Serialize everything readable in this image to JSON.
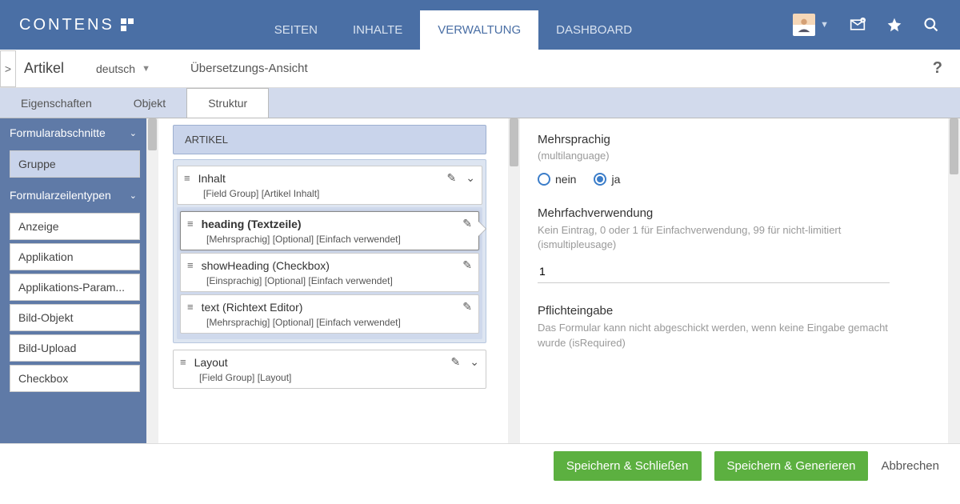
{
  "brand": "CONTENS",
  "topnav": {
    "seiten": "SEITEN",
    "inhalte": "INHALTE",
    "verwaltung": "VERWALTUNG",
    "dashboard": "DASHBOARD"
  },
  "subbar": {
    "title": "Artikel",
    "lang": "deutsch",
    "trans": "Übersetzungs-Ansicht"
  },
  "tabs": {
    "eigenschaften": "Eigenschaften",
    "objekt": "Objekt",
    "struktur": "Struktur"
  },
  "sidebar": {
    "sec1": "Formularabschnitte",
    "gruppe": "Gruppe",
    "sec2": "Formularzeilentypen",
    "items": [
      "Anzeige",
      "Applikation",
      "Applikations-Param...",
      "Bild-Objekt",
      "Bild-Upload",
      "Checkbox"
    ]
  },
  "center": {
    "artikel": "ARTIKEL",
    "row1": {
      "title": "Inhalt",
      "sub": "[Field Group] [Artikel Inhalt]"
    },
    "row2": {
      "title": "heading (Textzeile)",
      "sub": "[Mehrsprachig] [Optional] [Einfach verwendet]"
    },
    "row3": {
      "title": "showHeading (Checkbox)",
      "sub": "[Einsprachig] [Optional] [Einfach verwendet]"
    },
    "row4": {
      "title": "text (Richtext Editor)",
      "sub": "[Mehrsprachig] [Optional] [Einfach verwendet]"
    },
    "row5": {
      "title": "Layout",
      "sub": "[Field Group] [Layout]"
    }
  },
  "right": {
    "ml_label": "Mehrsprachig",
    "ml_tech": "(multilanguage)",
    "nein": "nein",
    "ja": "ja",
    "mv_label": "Mehrfachverwendung",
    "mv_desc": "Kein Eintrag, 0 oder 1 für Einfachverwendung, 99 für nicht-limitiert (ismultipleusage)",
    "mv_value": "1",
    "pf_label": "Pflichteingabe",
    "pf_desc": "Das Formular kann nicht abgeschickt werden, wenn keine Eingabe gemacht wurde (isRequired)"
  },
  "footer": {
    "save_close": "Speichern & Schließen",
    "save_gen": "Speichern & Generieren",
    "cancel": "Abbrechen"
  }
}
